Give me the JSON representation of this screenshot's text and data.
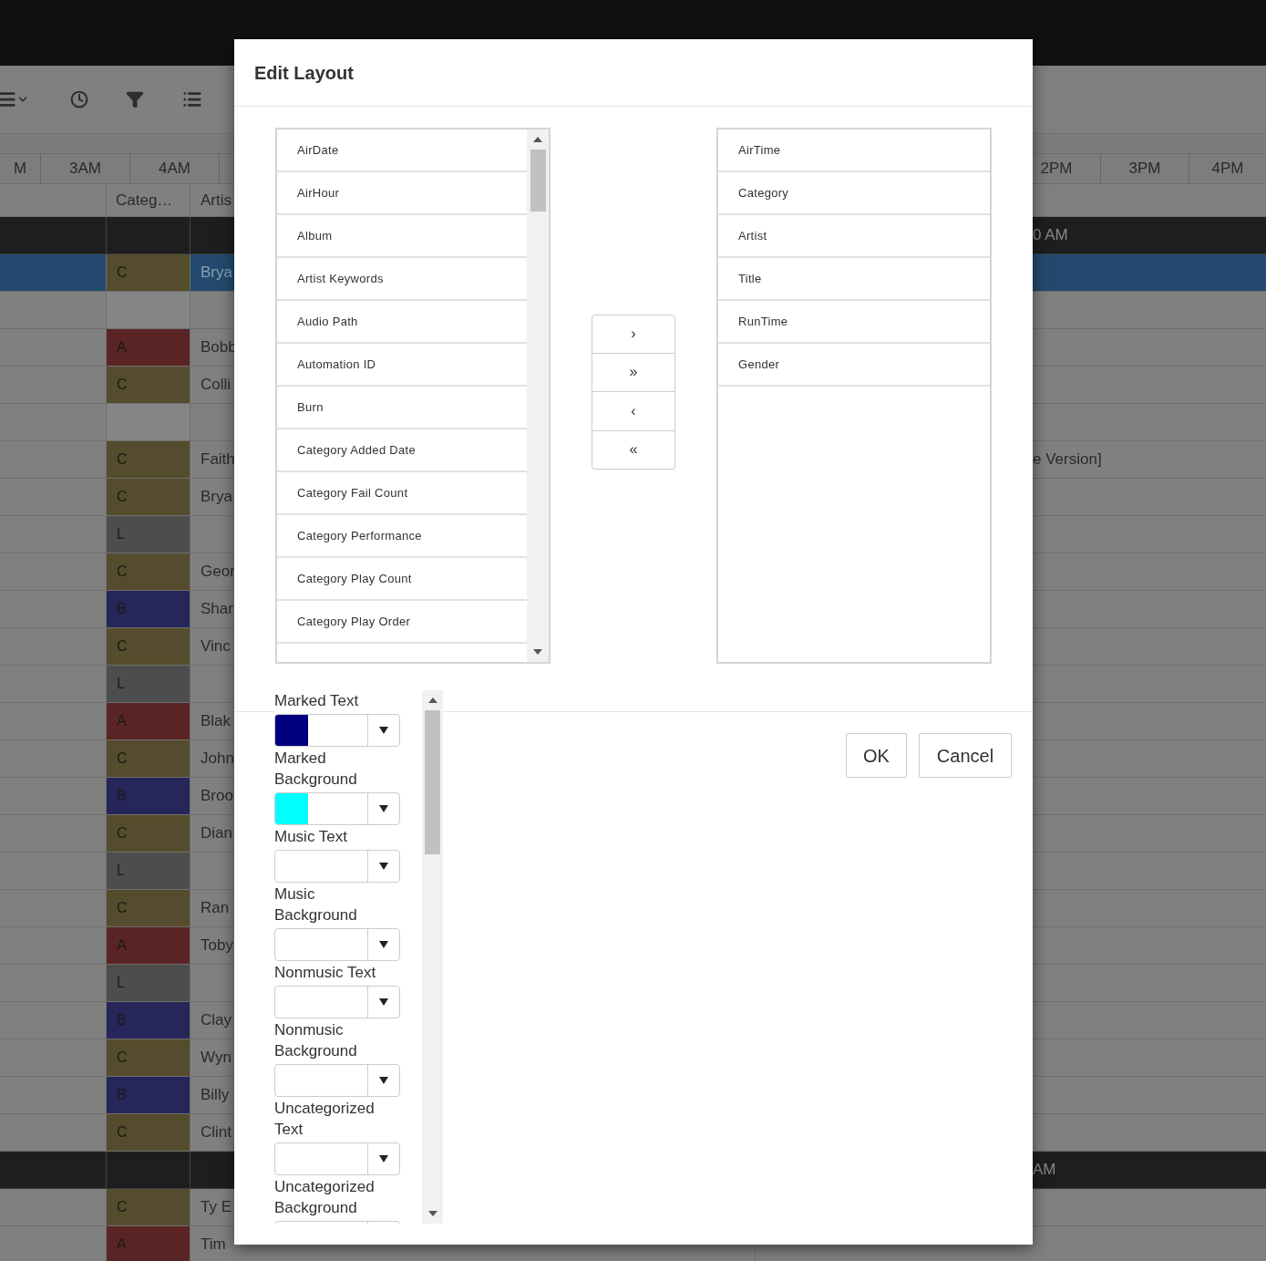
{
  "hours_left": [
    "M",
    "3AM",
    "4AM"
  ],
  "hours_right": [
    "2PM",
    "3PM",
    "4PM"
  ],
  "columns": [
    "Categ…",
    "Artis"
  ],
  "rows": [
    {
      "kind": "header",
      "column_5": "0 AM"
    },
    {
      "kind": "track",
      "selected": true,
      "category": "C",
      "color": "#554c2d",
      "artist": "Brya"
    },
    {
      "kind": "gap"
    },
    {
      "kind": "track",
      "selected": false,
      "category": "A",
      "color": "#5b2424",
      "artist": "Bobb"
    },
    {
      "kind": "track",
      "selected": false,
      "category": "C",
      "color": "#554c2d",
      "artist": "Colli"
    },
    {
      "kind": "gap"
    },
    {
      "kind": "track",
      "selected": false,
      "category": "C",
      "color": "#554c2d",
      "artist": "Faith",
      "column_5": "e Version]"
    },
    {
      "kind": "track",
      "selected": false,
      "category": "C",
      "color": "#554c2d",
      "artist": "Brya"
    },
    {
      "kind": "track",
      "selected": false,
      "category": "L",
      "color": "#4d4d4d"
    },
    {
      "kind": "track",
      "selected": false,
      "category": "C",
      "color": "#554c2d",
      "artist": "Geor"
    },
    {
      "kind": "track",
      "selected": false,
      "category": "B",
      "color": "#26265a",
      "artist": "Shar"
    },
    {
      "kind": "track",
      "selected": false,
      "category": "C",
      "color": "#554c2d",
      "artist": "Vinc"
    },
    {
      "kind": "track",
      "selected": false,
      "category": "L",
      "color": "#4d4d4d"
    },
    {
      "kind": "track",
      "selected": false,
      "category": "A",
      "color": "#5b2424",
      "artist": "Blak"
    },
    {
      "kind": "track",
      "selected": false,
      "category": "C",
      "color": "#554c2d",
      "artist": "John"
    },
    {
      "kind": "track",
      "selected": false,
      "category": "B",
      "color": "#26265a",
      "artist": "Broo"
    },
    {
      "kind": "track",
      "selected": false,
      "category": "C",
      "color": "#554c2d",
      "artist": "Dian"
    },
    {
      "kind": "track",
      "selected": false,
      "category": "L",
      "color": "#4d4d4d"
    },
    {
      "kind": "track",
      "selected": false,
      "category": "C",
      "color": "#554c2d",
      "artist": "Ran"
    },
    {
      "kind": "track",
      "selected": false,
      "category": "A",
      "color": "#5b2424",
      "artist": "Toby"
    },
    {
      "kind": "track",
      "selected": false,
      "category": "L",
      "color": "#4d4d4d"
    },
    {
      "kind": "track",
      "selected": false,
      "category": "B",
      "color": "#26265a",
      "artist": "Clay"
    },
    {
      "kind": "track",
      "selected": false,
      "category": "C",
      "color": "#554c2d",
      "artist": "Wyn"
    },
    {
      "kind": "track",
      "selected": false,
      "category": "B",
      "color": "#26265a",
      "artist": "Billy"
    },
    {
      "kind": "track",
      "selected": false,
      "category": "C",
      "color": "#554c2d",
      "artist": "Clint"
    },
    {
      "kind": "header",
      "column_5": "AM"
    },
    {
      "kind": "track",
      "selected": false,
      "category": "C",
      "color": "#554c2d",
      "artist": "Ty E"
    },
    {
      "kind": "track",
      "selected": false,
      "category": "A",
      "color": "#5b2424",
      "artist": "Tim"
    }
  ],
  "dialog": {
    "title": "Edit Layout",
    "available_fields": [
      "AirDate",
      "AirHour",
      "Album",
      "Artist Keywords",
      "Audio Path",
      "Automation ID",
      "Burn",
      "Category Added Date",
      "Category Fail Count",
      "Category Performance",
      "Category Play Count",
      "Category Play Order"
    ],
    "move_buttons": [
      "›",
      "»",
      "‹",
      "«"
    ],
    "selected_fields": [
      "AirTime",
      "Category",
      "Artist",
      "Title",
      "RunTime",
      "Gender"
    ],
    "color_settings": [
      {
        "label": "Marked Text",
        "color": "#000080"
      },
      {
        "label": "Marked Background",
        "color": "#00ffff"
      },
      {
        "label": "Music Text"
      },
      {
        "label": "Music Background"
      },
      {
        "label": "Nonmusic Text"
      },
      {
        "label": "Nonmusic Background"
      },
      {
        "label": "Uncategorized Text"
      },
      {
        "label": "Uncategorized Background"
      }
    ],
    "buttons": [
      "OK",
      "Cancel"
    ]
  }
}
